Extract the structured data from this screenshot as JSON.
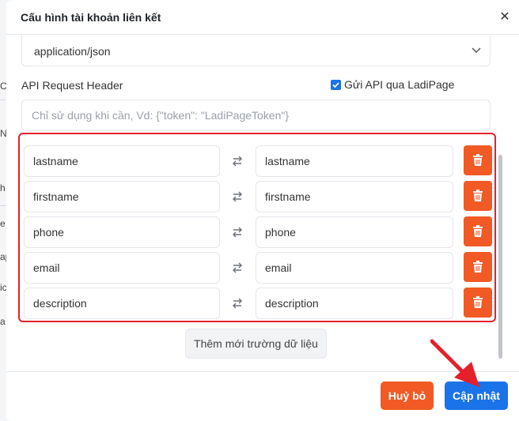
{
  "background": {
    "fragments": [
      "Ca",
      "N",
      "h",
      "e",
      "ap",
      "ic",
      "a"
    ]
  },
  "modal": {
    "title": "Cấu hình tài khoản liên kết",
    "content_type": "application/json",
    "api_header_label": "API Request Header",
    "send_via_ladipage_label": "Gửi API qua LadiPage",
    "send_via_ladipage_checked": true,
    "api_header_placeholder": "Chỉ sử dụng khi cần, Vd: {\"token\": \"LadiPageToken\"}",
    "api_header_value": "",
    "mappings": [
      {
        "source": "lastname",
        "target": "lastname"
      },
      {
        "source": "firstname",
        "target": "firstname"
      },
      {
        "source": "phone",
        "target": "phone"
      },
      {
        "source": "email",
        "target": "email"
      },
      {
        "source": "description",
        "target": "description"
      }
    ],
    "add_field_label": "Thêm mới trường dữ liệu",
    "cancel_label": "Huỷ bỏ",
    "update_label": "Cập nhật"
  },
  "colors": {
    "accent_blue": "#1a73e8",
    "danger_orange": "#f15a24",
    "highlight_red": "#e5202b"
  },
  "icons": {
    "close": "close-icon",
    "chevron": "chevron-down-icon",
    "swap": "swap-arrows-icon",
    "delete": "trash-icon",
    "pointer": "red-arrow-annotation-icon"
  }
}
